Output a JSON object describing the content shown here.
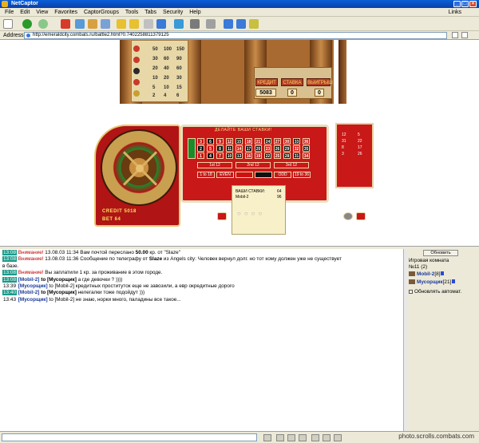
{
  "window": {
    "title": "NetCaptor"
  },
  "menu": [
    "File",
    "Edit",
    "View",
    "Favorites",
    "CaptorGroups",
    "Tools",
    "Tabs",
    "Security",
    "Help"
  ],
  "menu_links": "Links",
  "address": {
    "label": "Address",
    "url": "http://emeraldcity.combats.ru/battle2.html?0.7402258811379125"
  },
  "building": {
    "panel_rows": [
      {
        "values": [
          "50",
          "100",
          "150"
        ]
      },
      {
        "values": [
          "30",
          "60",
          "90"
        ]
      },
      {
        "values": [
          "20",
          "40",
          "60"
        ]
      },
      {
        "values": [
          "10",
          "20",
          "30"
        ]
      },
      {
        "values": [
          "5",
          "10",
          "15"
        ]
      },
      {
        "values": [
          "2",
          "4",
          "6"
        ]
      }
    ],
    "credit_label": "КРЕДИТ",
    "bet_label": "СТАВКА",
    "win_label": "ВЫИГРЫШ",
    "credit_value": "5083",
    "bet_value": "0",
    "win_value": "0"
  },
  "roulette": {
    "header": "ДЕЛАЙТЕ ВАШИ СТАВКИ!",
    "rows": [
      [
        {
          "n": "3",
          "c": "r"
        },
        {
          "n": "6",
          "c": "b"
        },
        {
          "n": "9",
          "c": "r"
        },
        {
          "n": "12",
          "c": "r"
        },
        {
          "n": "15",
          "c": "b"
        },
        {
          "n": "18",
          "c": "r"
        },
        {
          "n": "21",
          "c": "r"
        },
        {
          "n": "24",
          "c": "b"
        },
        {
          "n": "27",
          "c": "r"
        },
        {
          "n": "30",
          "c": "r"
        },
        {
          "n": "33",
          "c": "b"
        },
        {
          "n": "36",
          "c": "r"
        }
      ],
      [
        {
          "n": "2",
          "c": "b"
        },
        {
          "n": "5",
          "c": "r"
        },
        {
          "n": "8",
          "c": "b"
        },
        {
          "n": "11",
          "c": "b"
        },
        {
          "n": "14",
          "c": "r"
        },
        {
          "n": "17",
          "c": "b"
        },
        {
          "n": "20",
          "c": "b"
        },
        {
          "n": "23",
          "c": "r"
        },
        {
          "n": "26",
          "c": "b"
        },
        {
          "n": "29",
          "c": "b"
        },
        {
          "n": "32",
          "c": "r"
        },
        {
          "n": "35",
          "c": "b"
        }
      ],
      [
        {
          "n": "1",
          "c": "r"
        },
        {
          "n": "4",
          "c": "b"
        },
        {
          "n": "7",
          "c": "r"
        },
        {
          "n": "10",
          "c": "b"
        },
        {
          "n": "13",
          "c": "b"
        },
        {
          "n": "16",
          "c": "r"
        },
        {
          "n": "19",
          "c": "r"
        },
        {
          "n": "22",
          "c": "b"
        },
        {
          "n": "25",
          "c": "r"
        },
        {
          "n": "28",
          "c": "b"
        },
        {
          "n": "31",
          "c": "b"
        },
        {
          "n": "34",
          "c": "r"
        }
      ]
    ],
    "dozens": [
      "1st 12",
      "2nd 12",
      "3rd 12"
    ],
    "outside": [
      "1 to 18",
      "EVEN",
      "",
      "",
      "ODD",
      "19 to 36"
    ],
    "credit_text": "CREDIT 5018",
    "bet_text": "BET 64",
    "tooltip": {
      "line1": "ВАШИ СТАВКИ:",
      "line1_val": "64",
      "line2": "Mobil-2",
      "line2_val": "96"
    },
    "history": [
      "12",
      "5",
      "31",
      "22",
      "8",
      "17",
      "3",
      "26"
    ]
  },
  "chat": {
    "lines": [
      {
        "ts": "13:08",
        "ts_hl": true,
        "warn": "Внимание!",
        "text": " 13.08.03 11:34 Вам почтой переслано ",
        "bold": "50.00",
        "text2": " кр. от \"Slaze\""
      },
      {
        "ts": "13:08",
        "ts_hl": true,
        "warn": "Внимание!",
        "text": " 13.08.03 11:36 Сообщение по телеграфу от ",
        "bold": "Slaze",
        "text2": " из Angels city: Человек вернул долг. но тот кому должен уже не существует"
      },
      {
        "ts": "",
        "ts_hl": false,
        "warn": "",
        "text": "в базе.",
        "bold": "",
        "text2": ""
      },
      {
        "ts": "13:08",
        "ts_hl": true,
        "warn": "Внимание!",
        "text": " Вы заплатили 1 кр. за проживание в этом городе.",
        "bold": "",
        "text2": ""
      },
      {
        "ts": "13:08",
        "ts_hl": true,
        "nick": "[Mobil-2]",
        "text": " ",
        "bold": "to [Мусорщик]",
        "text2": " а где девочки ? ))))"
      },
      {
        "ts": "13:39",
        "ts_hl": false,
        "nick": "[Мусорщик]",
        "text": " to [Mobil-2] кредитных проституток еще не завозили, а евр окредитные дорого",
        "bold": "",
        "text2": ""
      },
      {
        "ts": "13:40",
        "ts_hl": true,
        "nick": "[Mobil-2]",
        "text": " ",
        "bold": "to [Мусорщик]",
        "text2": " нелегалки тоже подойдут )))"
      },
      {
        "ts": "13:43",
        "ts_hl": false,
        "nick": "[Мусорщик]",
        "text": " to [Mobil-2] не знаю, норки много, паладины все такое...",
        "bold": "",
        "text2": ""
      }
    ]
  },
  "room": {
    "refresh_label": "Обновить",
    "title": "Игровая комната",
    "subtitle": "№11 (2)",
    "users": [
      {
        "name": "Mobil-2",
        "level": "[8]"
      },
      {
        "name": "Мусорщик",
        "level": "[21]"
      }
    ],
    "auto_label": "Обновлять автомат."
  },
  "watermark": "photo.scrolls.combats.com"
}
